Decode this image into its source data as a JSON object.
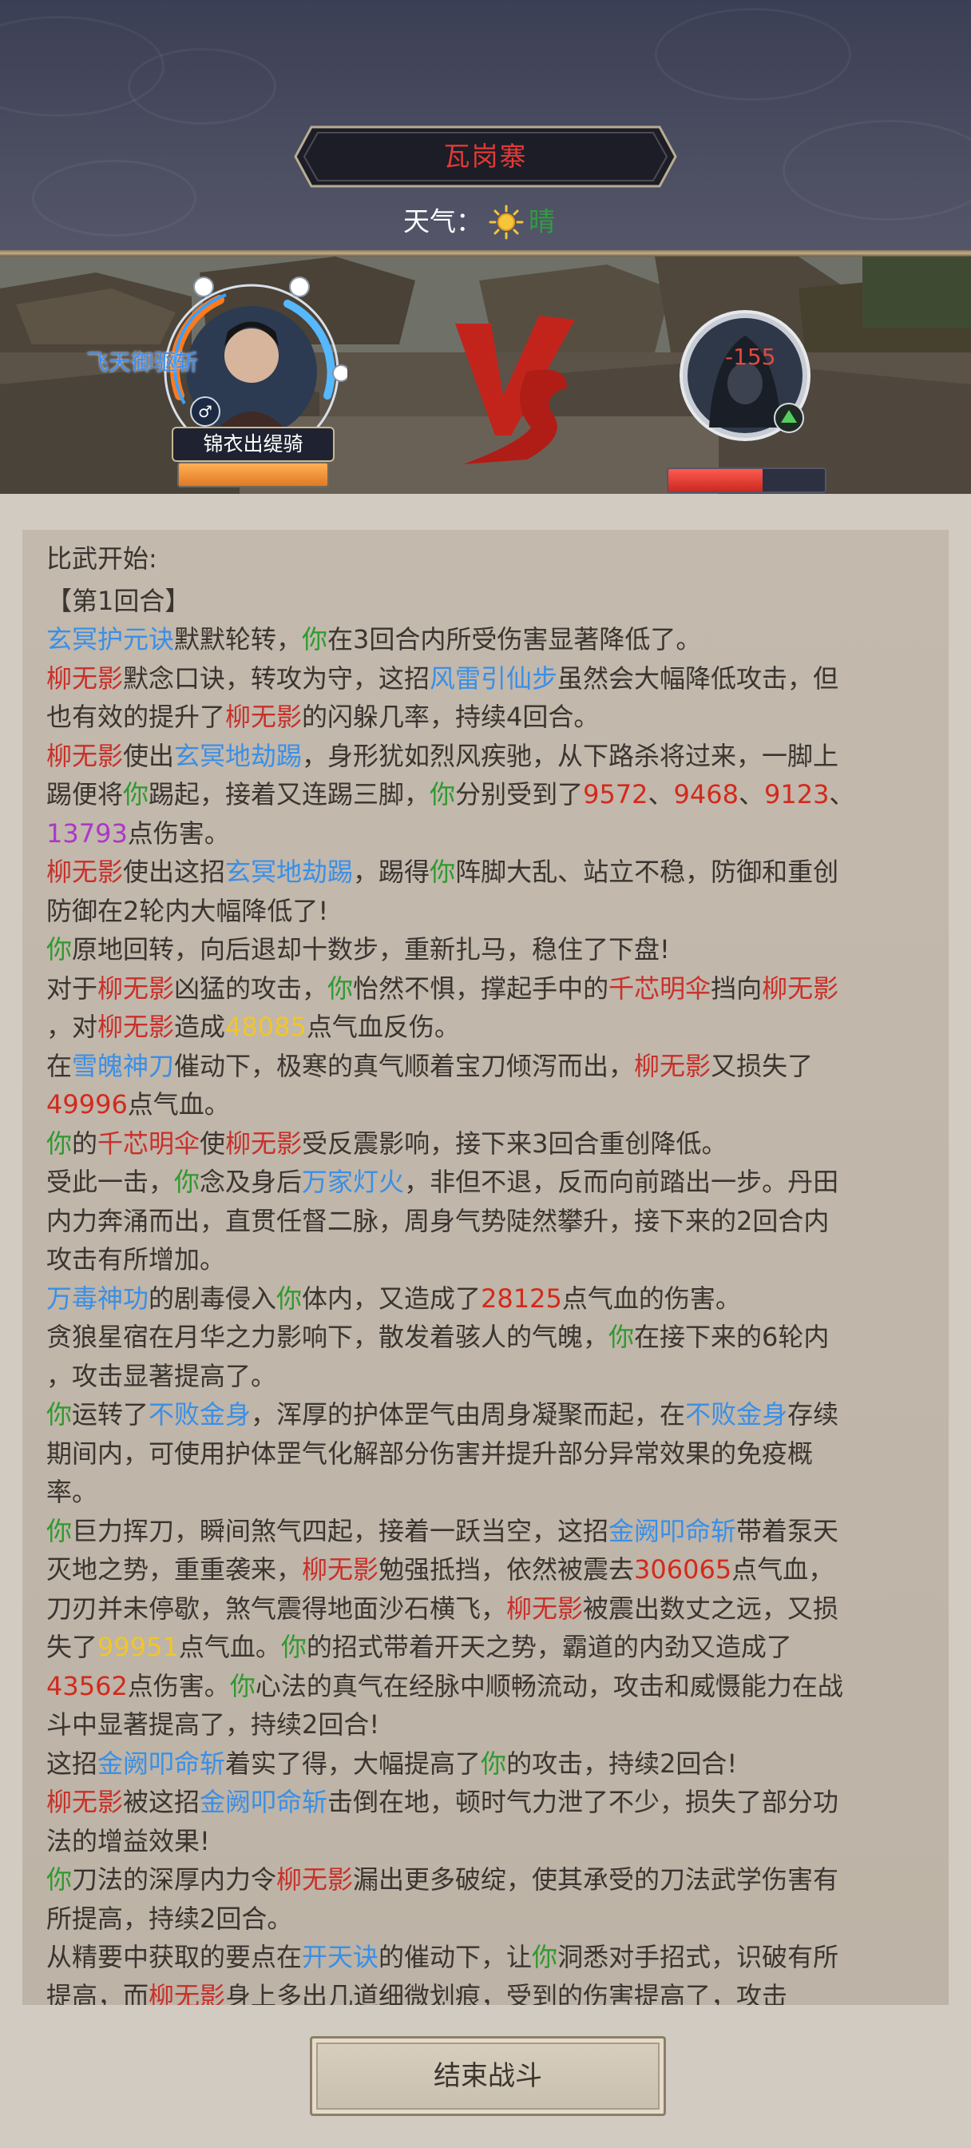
{
  "header": {
    "location": "瓦岗寨",
    "weather_label": "天气：",
    "weather_icon": "sun-icon",
    "weather_value": "晴"
  },
  "battle": {
    "player": {
      "name": "锦衣出缇骑",
      "floating_text": "飞天御驱斩",
      "gender_icon": "male-icon",
      "hp_fraction": 1.0
    },
    "enemy": {
      "floating_text": "-155",
      "hp_fraction": 0.6
    },
    "vs_icon": "vs-icon"
  },
  "log": {
    "lines": [
      [
        {
          "t": "比武开始:",
          "c": "default"
        }
      ],
      [
        {
          "t": "【第1回合】",
          "c": "default"
        }
      ],
      [
        {
          "t": "玄冥护元诀",
          "c": "skill"
        },
        {
          "t": "默默轮转，",
          "c": "default"
        },
        {
          "t": "你",
          "c": "you"
        },
        {
          "t": "在3回合内所受伤害显著降低了。",
          "c": "default"
        }
      ],
      [
        {
          "t": "柳无影",
          "c": "enemy"
        },
        {
          "t": "默念口诀，转攻为守，这招",
          "c": "default"
        },
        {
          "t": "风雷引仙步",
          "c": "skill"
        },
        {
          "t": "虽然会大幅降低攻击，但",
          "c": "default"
        }
      ],
      [
        {
          "t": "也有效的提升了",
          "c": "default"
        },
        {
          "t": "柳无影",
          "c": "enemy"
        },
        {
          "t": "的闪躲几率，持续4回合。",
          "c": "default"
        }
      ],
      [
        {
          "t": "柳无影",
          "c": "enemy"
        },
        {
          "t": "使出",
          "c": "default"
        },
        {
          "t": "玄冥地劫踢",
          "c": "skill"
        },
        {
          "t": "，身形犹如烈风疾驰，从下路杀将过来，一脚上",
          "c": "default"
        }
      ],
      [
        {
          "t": "踢便将",
          "c": "default"
        },
        {
          "t": "你",
          "c": "you"
        },
        {
          "t": "踢起，接着又连踢三脚，",
          "c": "default"
        },
        {
          "t": "你",
          "c": "you"
        },
        {
          "t": "分别受到了",
          "c": "default"
        },
        {
          "t": "9572",
          "c": "dmg"
        },
        {
          "t": "、",
          "c": "default"
        },
        {
          "t": "9468",
          "c": "dmg"
        },
        {
          "t": "、",
          "c": "default"
        },
        {
          "t": "9123",
          "c": "dmg"
        },
        {
          "t": "、",
          "c": "default"
        }
      ],
      [
        {
          "t": "13793",
          "c": "crit"
        },
        {
          "t": "点伤害。",
          "c": "default"
        }
      ],
      [
        {
          "t": "柳无影",
          "c": "enemy"
        },
        {
          "t": "使出这招",
          "c": "default"
        },
        {
          "t": "玄冥地劫踢",
          "c": "skill"
        },
        {
          "t": "，踢得",
          "c": "default"
        },
        {
          "t": "你",
          "c": "you"
        },
        {
          "t": "阵脚大乱、站立不稳，防御和重创",
          "c": "default"
        }
      ],
      [
        {
          "t": "防御在2轮内大幅降低了!",
          "c": "default"
        }
      ],
      [
        {
          "t": "你",
          "c": "you"
        },
        {
          "t": "原地回转，向后退却十数步，重新扎马，稳住了下盘!",
          "c": "default"
        }
      ],
      [
        {
          "t": "对于",
          "c": "default"
        },
        {
          "t": "柳无影",
          "c": "enemy"
        },
        {
          "t": "凶猛的攻击，",
          "c": "default"
        },
        {
          "t": "你",
          "c": "you"
        },
        {
          "t": "怡然不惧，撑起手中的",
          "c": "default"
        },
        {
          "t": "千芯明伞",
          "c": "item"
        },
        {
          "t": "挡向",
          "c": "default"
        },
        {
          "t": "柳无影",
          "c": "enemy"
        }
      ],
      [
        {
          "t": "，对",
          "c": "default"
        },
        {
          "t": "柳无影",
          "c": "enemy"
        },
        {
          "t": "造成",
          "c": "default"
        },
        {
          "t": "48085",
          "c": "heal"
        },
        {
          "t": "点气血反伤。",
          "c": "default"
        }
      ],
      [
        {
          "t": "在",
          "c": "default"
        },
        {
          "t": "雪魄神刀",
          "c": "skill"
        },
        {
          "t": "催动下，极寒的真气顺着宝刀倾泻而出，",
          "c": "default"
        },
        {
          "t": "柳无影",
          "c": "enemy"
        },
        {
          "t": "又损失了",
          "c": "default"
        }
      ],
      [
        {
          "t": "49996",
          "c": "dmg"
        },
        {
          "t": "点气血。",
          "c": "default"
        }
      ],
      [
        {
          "t": "你",
          "c": "you"
        },
        {
          "t": "的",
          "c": "default"
        },
        {
          "t": "千芯明伞",
          "c": "item"
        },
        {
          "t": "使",
          "c": "default"
        },
        {
          "t": "柳无影",
          "c": "enemy"
        },
        {
          "t": "受反震影响，接下来3回合重创降低。",
          "c": "default"
        }
      ],
      [
        {
          "t": "受此一击，",
          "c": "default"
        },
        {
          "t": "你",
          "c": "you"
        },
        {
          "t": "念及身后",
          "c": "default"
        },
        {
          "t": "万家灯火",
          "c": "skill"
        },
        {
          "t": "，非但不退，反而向前踏出一步。丹田",
          "c": "default"
        }
      ],
      [
        {
          "t": "内力奔涌而出，直贯任督二脉，周身气势陡然攀升，接下来的2回合内",
          "c": "default"
        }
      ],
      [
        {
          "t": "攻击有所增加。",
          "c": "default"
        }
      ],
      [
        {
          "t": "万毒神功",
          "c": "skill"
        },
        {
          "t": "的剧毒侵入",
          "c": "default"
        },
        {
          "t": "你",
          "c": "you"
        },
        {
          "t": "体内，又造成了",
          "c": "default"
        },
        {
          "t": "28125",
          "c": "dmg"
        },
        {
          "t": "点气血的伤害。",
          "c": "default"
        }
      ],
      [
        {
          "t": "贪狼星宿在月华之力影响下，散发着骇人的气魄，",
          "c": "default"
        },
        {
          "t": "你",
          "c": "you"
        },
        {
          "t": "在接下来的6轮内",
          "c": "default"
        }
      ],
      [
        {
          "t": "，攻击显著提高了。",
          "c": "default"
        }
      ],
      [
        {
          "t": "你",
          "c": "you"
        },
        {
          "t": "运转了",
          "c": "default"
        },
        {
          "t": "不败金身",
          "c": "skill"
        },
        {
          "t": "，浑厚的护体罡气由周身凝聚而起，在",
          "c": "default"
        },
        {
          "t": "不败金身",
          "c": "skill"
        },
        {
          "t": "存续",
          "c": "default"
        }
      ],
      [
        {
          "t": "期间内，可使用护体罡气化解部分伤害并提升部分异常效果的免疫概",
          "c": "default"
        }
      ],
      [
        {
          "t": "率。",
          "c": "default"
        }
      ],
      [
        {
          "t": "你",
          "c": "you"
        },
        {
          "t": "巨力挥刀，瞬间煞气四起，接着一跃当空，这招",
          "c": "default"
        },
        {
          "t": "金阙叩命斩",
          "c": "skill"
        },
        {
          "t": "带着泵天",
          "c": "default"
        }
      ],
      [
        {
          "t": "灭地之势，重重袭来，",
          "c": "default"
        },
        {
          "t": "柳无影",
          "c": "enemy"
        },
        {
          "t": "勉强抵挡，依然被震去",
          "c": "default"
        },
        {
          "t": "306065",
          "c": "dmg"
        },
        {
          "t": "点气血，",
          "c": "default"
        }
      ],
      [
        {
          "t": "刀刃并未停歇，煞气震得地面沙石横飞，",
          "c": "default"
        },
        {
          "t": "柳无影",
          "c": "enemy"
        },
        {
          "t": "被震出数丈之远，又损",
          "c": "default"
        }
      ],
      [
        {
          "t": "失了",
          "c": "default"
        },
        {
          "t": "99951",
          "c": "heal"
        },
        {
          "t": "点气血。",
          "c": "default"
        },
        {
          "t": "你",
          "c": "you"
        },
        {
          "t": "的招式带着开天之势，霸道的内劲又造成了",
          "c": "default"
        }
      ],
      [
        {
          "t": "43562",
          "c": "dmg"
        },
        {
          "t": "点伤害。",
          "c": "default"
        },
        {
          "t": "你",
          "c": "you"
        },
        {
          "t": "心法的真气在经脉中顺畅流动，攻击和威慑能力在战",
          "c": "default"
        }
      ],
      [
        {
          "t": "斗中显著提高了，持续2回合!",
          "c": "default"
        }
      ],
      [
        {
          "t": "这招",
          "c": "default"
        },
        {
          "t": "金阙叩命斩",
          "c": "skill"
        },
        {
          "t": "着实了得，大幅提高了",
          "c": "default"
        },
        {
          "t": "你",
          "c": "you"
        },
        {
          "t": "的攻击，持续2回合!",
          "c": "default"
        }
      ],
      [
        {
          "t": "柳无影",
          "c": "enemy"
        },
        {
          "t": "被这招",
          "c": "default"
        },
        {
          "t": "金阙叩命斩",
          "c": "skill"
        },
        {
          "t": "击倒在地，顿时气力泄了不少，损失了部分功",
          "c": "default"
        }
      ],
      [
        {
          "t": "法的增益效果!",
          "c": "default"
        }
      ],
      [
        {
          "t": "你",
          "c": "you"
        },
        {
          "t": "刀法的深厚内力令",
          "c": "default"
        },
        {
          "t": "柳无影",
          "c": "enemy"
        },
        {
          "t": "漏出更多破绽，使其承受的刀法武学伤害有",
          "c": "default"
        }
      ],
      [
        {
          "t": "所提高，持续2回合。",
          "c": "default"
        }
      ],
      [
        {
          "t": "从精要中获取的要点在",
          "c": "default"
        },
        {
          "t": "开天诀",
          "c": "skill"
        },
        {
          "t": "的催动下，让",
          "c": "default"
        },
        {
          "t": "你",
          "c": "you"
        },
        {
          "t": "洞悉对手招式，识破有所",
          "c": "default"
        }
      ],
      [
        {
          "t": "提高，而",
          "c": "default"
        },
        {
          "t": "柳无影",
          "c": "enemy"
        },
        {
          "t": "身上多出几道细微划痕，受到的伤害提高了，攻击",
          "c": "default"
        }
      ]
    ]
  },
  "footer": {
    "end_button": "结束战斗"
  },
  "colors": {
    "skill": "#3a8fe6",
    "enemy": "#c9302a",
    "you": "#2e9a2e",
    "damage": "#d22a1c",
    "critical": "#ad37c8",
    "reflect": "#f1c52a",
    "title": "#e23a35"
  }
}
